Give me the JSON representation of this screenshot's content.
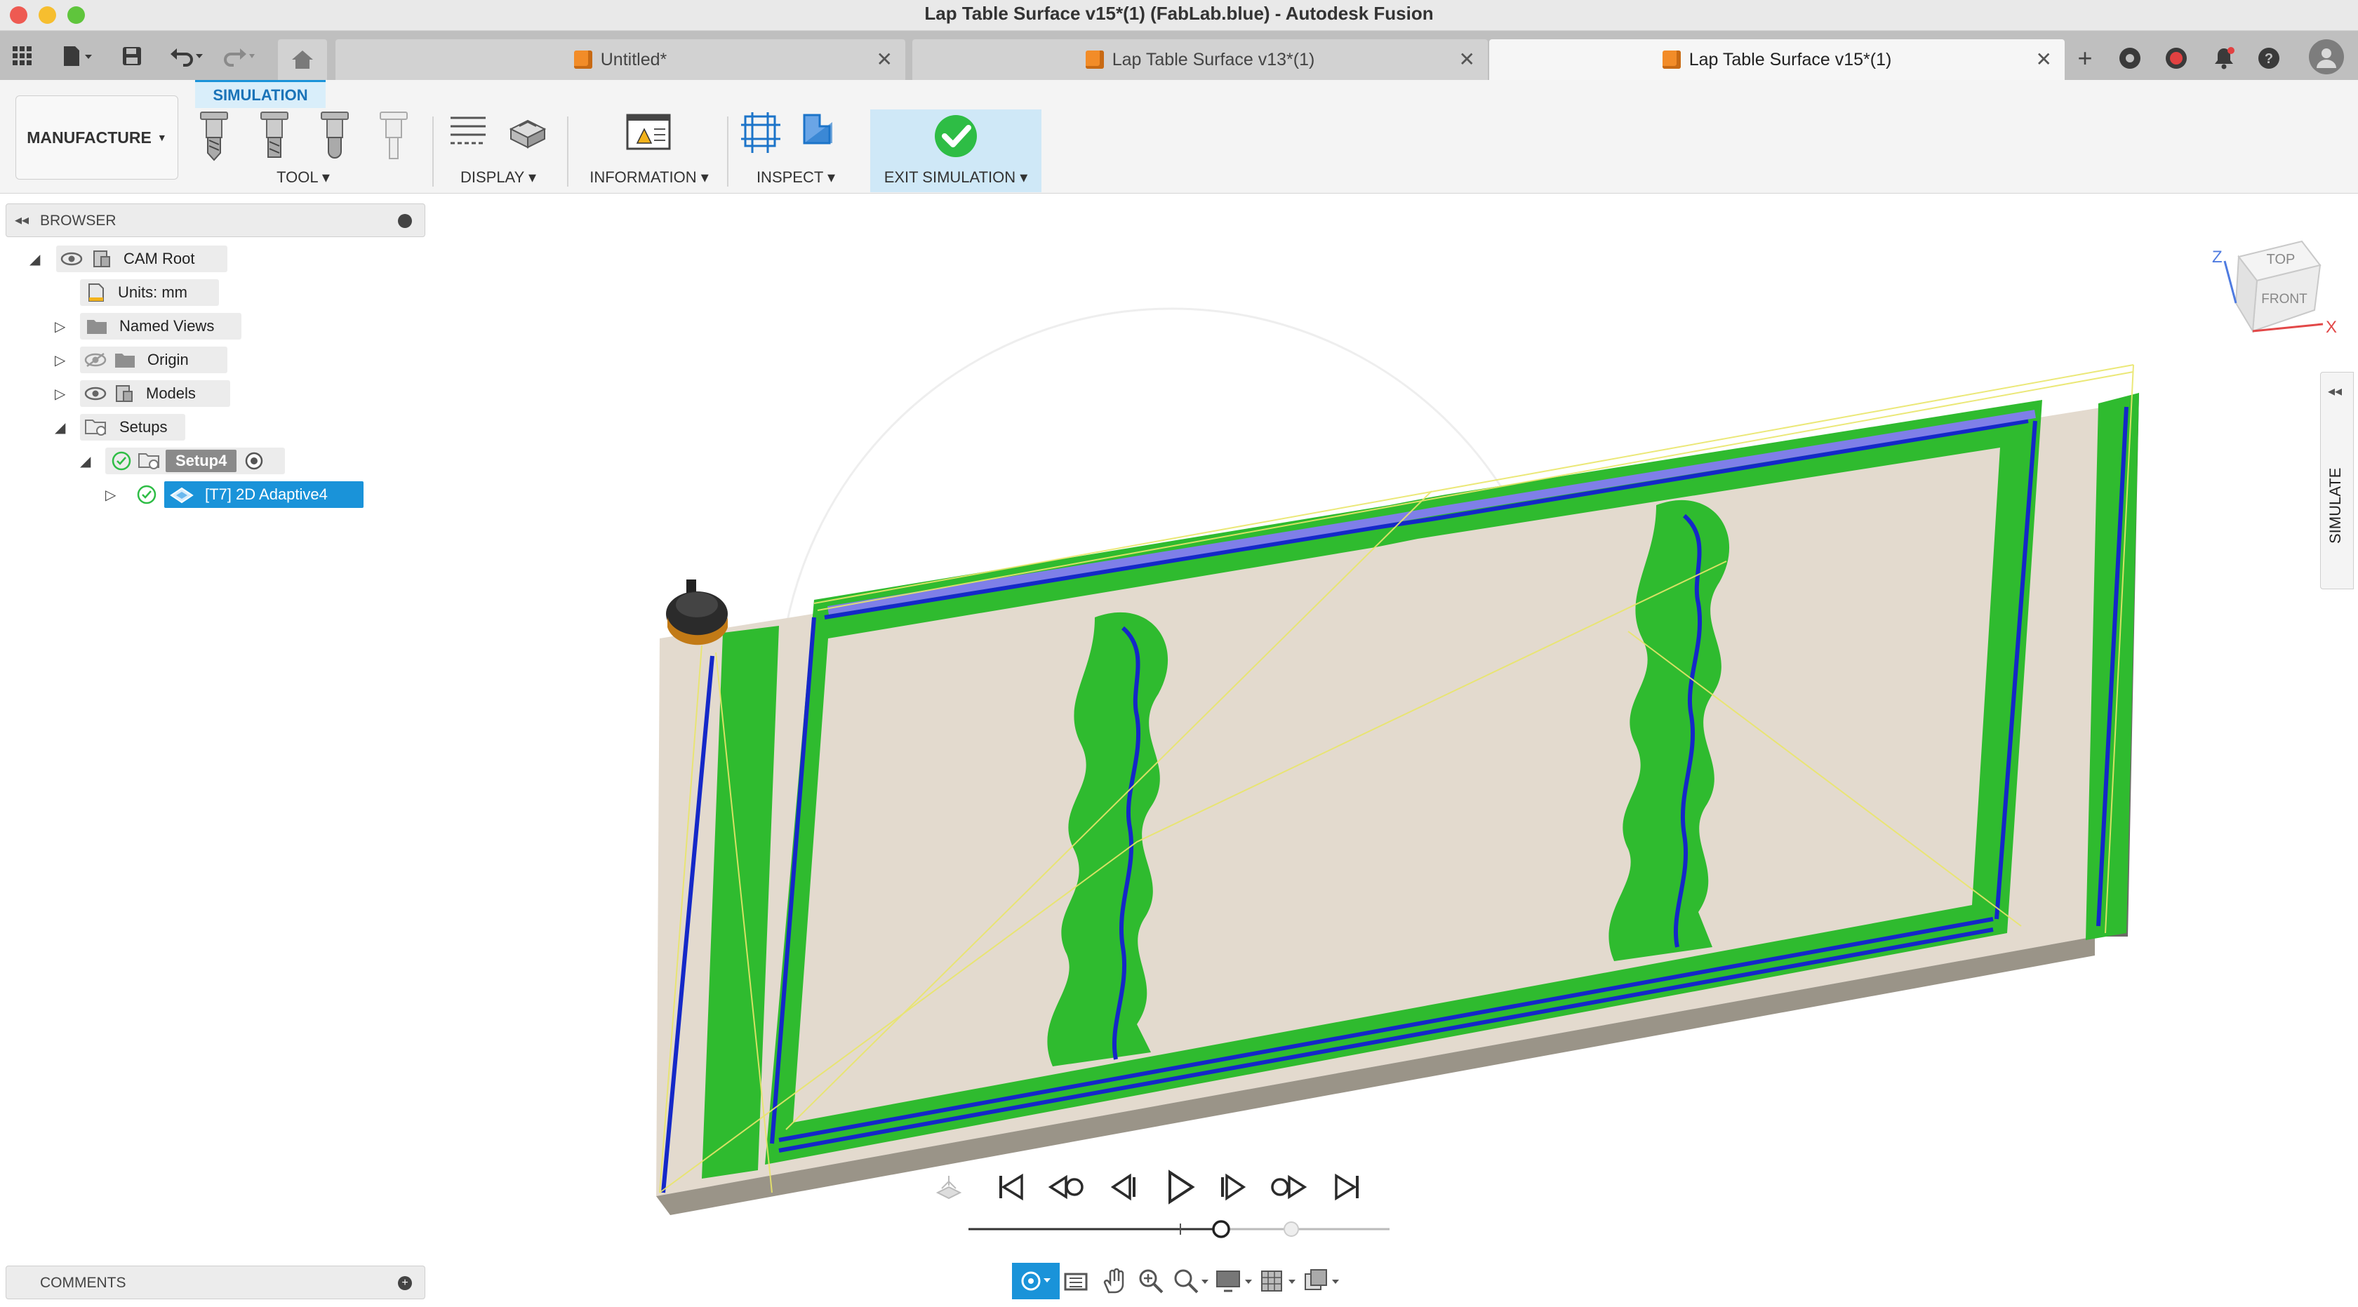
{
  "window": {
    "title": "Lap Table Surface v15*(1) (FabLab.blue) - Autodesk Fusion"
  },
  "tabs": [
    {
      "label": "Untitled*",
      "active": false
    },
    {
      "label": "Lap Table Surface v13*(1)",
      "active": false
    },
    {
      "label": "Lap Table Surface v15*(1)",
      "active": true
    }
  ],
  "toolbar": {
    "workspace": "MANUFACTURE",
    "active_tab": "SIMULATION",
    "groups": {
      "tool": "TOOL",
      "display": "DISPLAY",
      "information": "INFORMATION",
      "inspect": "INSPECT",
      "exit": "EXIT SIMULATION"
    }
  },
  "browser": {
    "title": "BROWSER",
    "items": {
      "cam_root": "CAM Root",
      "units": "Units: mm",
      "named_views": "Named Views",
      "origin": "Origin",
      "models": "Models",
      "setups": "Setups",
      "setup4": "Setup4",
      "operation": "[T7] 2D Adaptive4"
    }
  },
  "viewcube": {
    "top": "TOP",
    "front": "FRONT",
    "axis_x": "X",
    "axis_z": "Z"
  },
  "side_panel": {
    "label": "SIMULATE"
  },
  "comments": {
    "title": "COMMENTS"
  },
  "playback": {
    "progress": 0.6
  },
  "colors": {
    "stock": "#e3dace",
    "toolpath_green": "#2fbb2f",
    "toolpath_blue": "#1428c8",
    "accent": "#1a93d9",
    "exit_check": "#2ebd45"
  }
}
